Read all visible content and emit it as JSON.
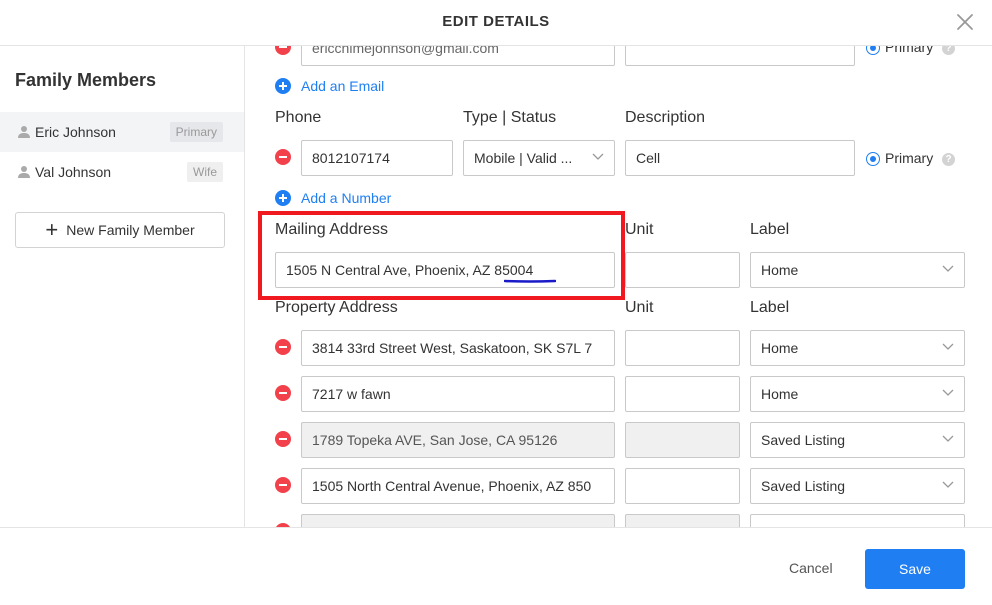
{
  "modal": {
    "title": "EDIT DETAILS"
  },
  "sidebar": {
    "title": "Family Members",
    "members": [
      {
        "name": "Eric Johnson",
        "tag": "Primary"
      },
      {
        "name": "Val Johnson",
        "tag": "Wife"
      }
    ],
    "new_member_label": "New Family Member"
  },
  "email": {
    "partial_value": "ericchimejohnson@gmail.com",
    "primary_label": "Primary",
    "add_label": "Add an Email"
  },
  "phone": {
    "header_phone": "Phone",
    "header_type": "Type | Status",
    "header_description": "Description",
    "number": "8012107174",
    "type_status": "Mobile | Valid ...",
    "description": "Cell",
    "primary_label": "Primary",
    "add_label": "Add a Number"
  },
  "mailing": {
    "header_address": "Mailing Address",
    "header_unit": "Unit",
    "header_label": "Label",
    "address": "1505 N Central Ave, Phoenix, AZ 85004",
    "unit": "",
    "label": "Home"
  },
  "property": {
    "header_address": "Property Address",
    "header_unit": "Unit",
    "header_label": "Label",
    "rows": [
      {
        "address": "3814 33rd Street West, Saskatoon, SK S7L 7",
        "unit": "",
        "label": "Home",
        "disabled": false
      },
      {
        "address": "7217 w fawn",
        "unit": "",
        "label": "Home",
        "disabled": false
      },
      {
        "address": "1789 Topeka AVE, San Jose, CA 95126",
        "unit": "",
        "label": "Saved Listing",
        "disabled": true
      },
      {
        "address": "1505 North Central Avenue, Phoenix, AZ 850",
        "unit": "",
        "label": "Saved Listing",
        "disabled": false
      }
    ]
  },
  "footer": {
    "cancel_label": "Cancel",
    "save_label": "Save"
  },
  "colors": {
    "accent": "#1f7ff2",
    "remove": "#f2414b",
    "annotation_box": "#f0191f",
    "annotation_underline": "#1a1ac8"
  }
}
